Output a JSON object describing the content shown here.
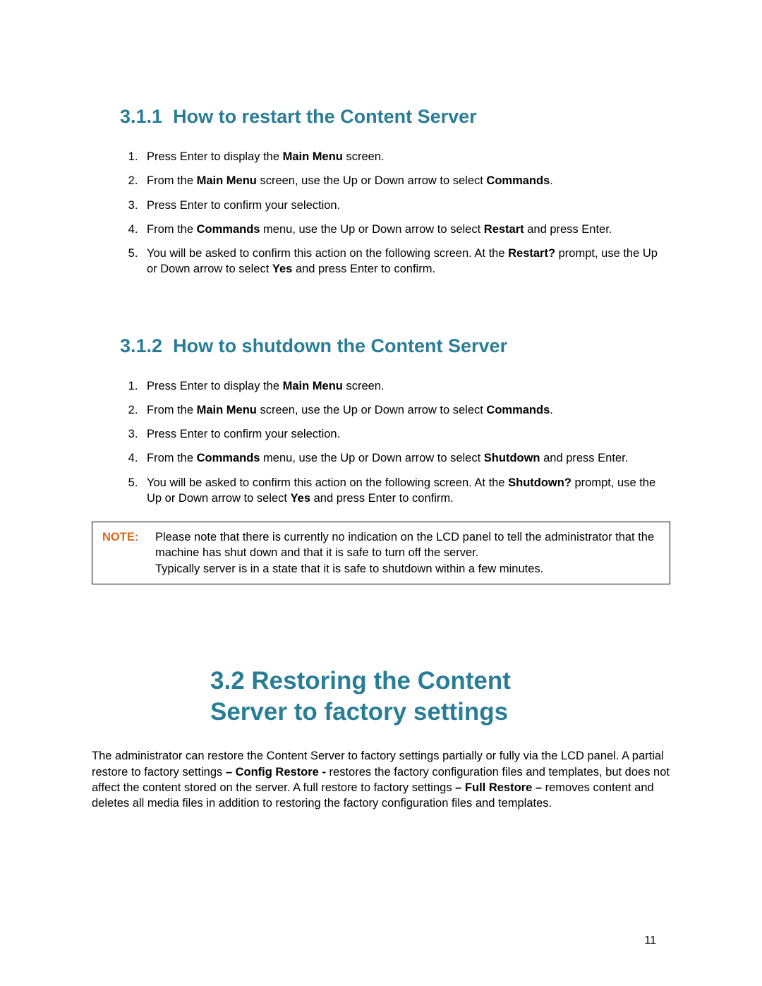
{
  "section311": {
    "number": "3.1.1",
    "title": "How to restart the Content Server",
    "steps": [
      {
        "pre": "Press Enter to display the ",
        "b": "Main Menu",
        "post": " screen."
      },
      {
        "pre": "From the ",
        "b": "Main Menu",
        "mid": " screen, use the Up or Down arrow to select ",
        "b2": "Commands",
        "post": "."
      },
      {
        "pre": "Press Enter to confirm your selection.",
        "b": "",
        "post": ""
      },
      {
        "pre": "From the ",
        "b": "Commands",
        "mid": " menu, use the Up or Down arrow to select ",
        "b2": "Restart",
        "post": " and press Enter."
      },
      {
        "pre": "You will be asked to confirm this action on the following screen. At the ",
        "b": "Restart?",
        "mid": " prompt, use the Up or Down arrow to select ",
        "b2": "Yes",
        "post": " and press Enter to confirm."
      }
    ]
  },
  "section312": {
    "number": "3.1.2",
    "title": "How to shutdown the Content Server",
    "steps": [
      {
        "pre": "Press Enter to display the ",
        "b": "Main Menu",
        "post": " screen."
      },
      {
        "pre": "From the ",
        "b": "Main Menu",
        "mid": " screen, use the Up or Down arrow to select ",
        "b2": "Commands",
        "post": "."
      },
      {
        "pre": "Press Enter to confirm your selection.",
        "b": "",
        "post": ""
      },
      {
        "pre": "From the ",
        "b": "Commands",
        "mid": " menu, use the Up or Down arrow to select ",
        "b2": "Shutdown",
        "post": " and press Enter."
      },
      {
        "pre": "You will be asked to confirm this action on the following screen. At the ",
        "b": "Shutdown?",
        "mid": " prompt, use the Up or Down arrow to select ",
        "b2": "Yes",
        "post": " and press Enter to confirm."
      }
    ]
  },
  "note": {
    "label": "NOTE:",
    "line1": "Please note that there is currently no indication on the LCD panel to tell the administrator that the machine has shut down and that it is safe to turn off the server.",
    "line2": "Typically server is in a state that it is safe to shutdown within a few minutes."
  },
  "section32": {
    "number": "3.2",
    "title": "Restoring the Content Server to factory settings",
    "para_pre": "The administrator can restore the Content Server to factory settings partially or fully via the LCD panel. A partial restore to factory settings ",
    "para_b1": "– Config Restore -",
    "para_mid": " restores the factory configuration files and templates, but does not affect the content stored on the server. A full restore to factory settings ",
    "para_b2": "– Full Restore –",
    "para_post": " removes content and deletes all media files in addition to restoring the factory configuration files and templates."
  },
  "page_number": "11"
}
